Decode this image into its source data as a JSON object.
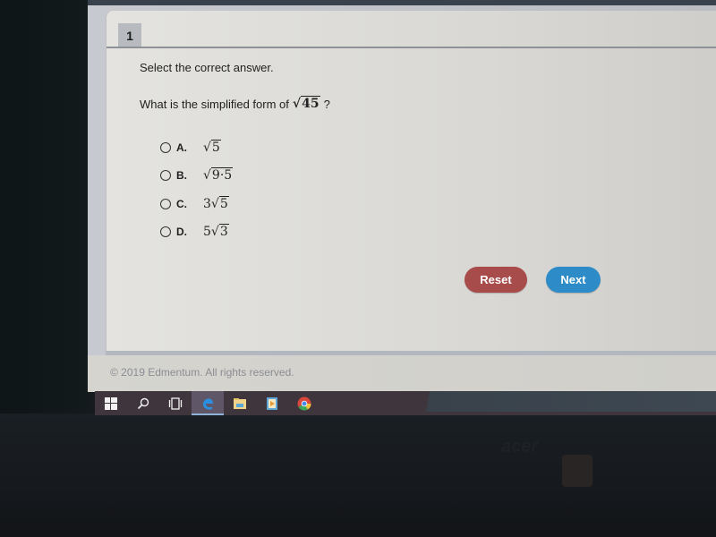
{
  "question": {
    "number": "1",
    "instruction": "Select the correct answer.",
    "prompt": "What is the simplified form of",
    "prompt_radicand": "45",
    "prompt_suffix": "?",
    "options": [
      {
        "letter": "A.",
        "coefficient": "",
        "radicand": "5"
      },
      {
        "letter": "B.",
        "coefficient": "",
        "radicand": "9·5"
      },
      {
        "letter": "C.",
        "coefficient": "3",
        "radicand": "5"
      },
      {
        "letter": "D.",
        "coefficient": "5",
        "radicand": "3"
      }
    ]
  },
  "buttons": {
    "reset_label": "Reset",
    "next_label": "Next",
    "reset_color": "#a84b4b",
    "next_color": "#2d8bc7"
  },
  "footer": {
    "copyright": "© 2019 Edmentum. All rights reserved."
  },
  "taskbar": {
    "items": [
      {
        "icon": "windows-start-icon"
      },
      {
        "icon": "search-icon"
      },
      {
        "icon": "task-view-icon"
      },
      {
        "icon": "edge-browser-icon",
        "active": true
      },
      {
        "icon": "file-explorer-icon"
      },
      {
        "icon": "media-player-icon"
      },
      {
        "icon": "chrome-icon"
      }
    ]
  },
  "device": {
    "brand": "acer"
  }
}
